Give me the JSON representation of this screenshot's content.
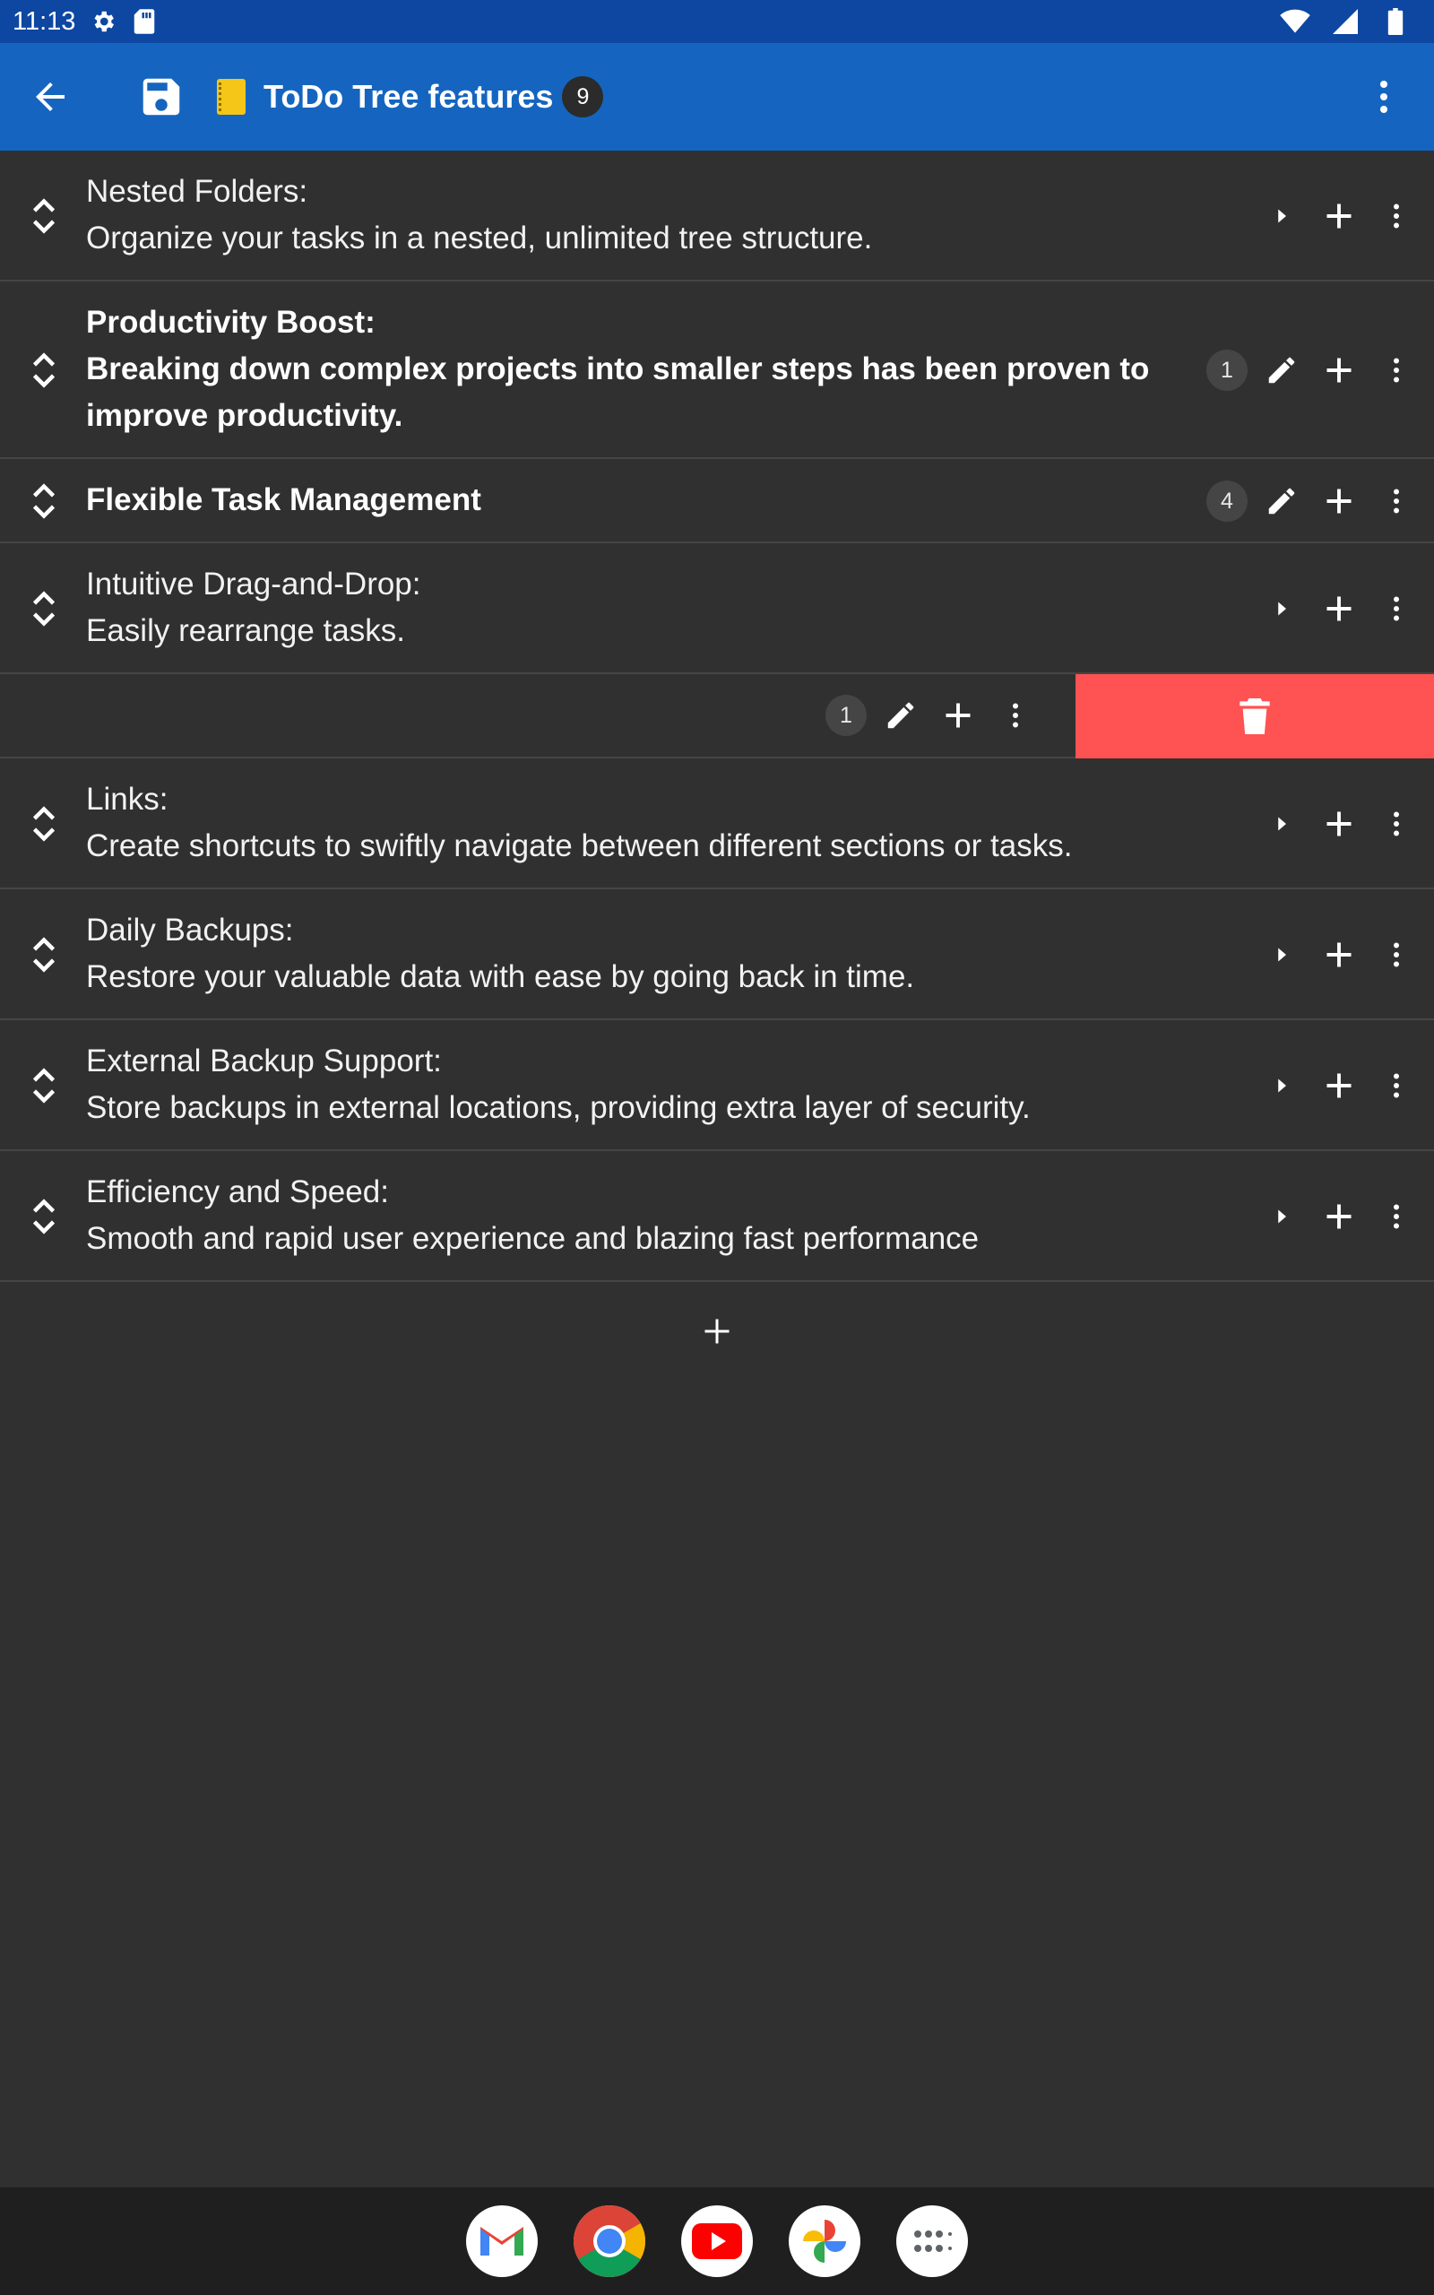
{
  "status_bar": {
    "time": "11:13"
  },
  "app_bar": {
    "title": "ToDo Tree features",
    "count": "9"
  },
  "items": [
    {
      "line1": "Nested Folders:",
      "line2": "Organize your tasks in a nested, unlimited tree structure.",
      "bold": false
    },
    {
      "line1": "Productivity Boost:",
      "line2": "Breaking down complex projects into smaller steps has been proven to",
      "line3": "improve productivity.",
      "badge": "1",
      "bold": true
    },
    {
      "line1": "Flexible Task Management",
      "badge": "4",
      "bold": true
    },
    {
      "line1": "Intuitive Drag-and-Drop:",
      "line2": "Easily rearrange tasks.",
      "bold": false
    },
    {
      "swiped_badge": "1"
    },
    {
      "line1": "Links:",
      "line2": "Create shortcuts to swiftly navigate between different sections or tasks.",
      "bold": false
    },
    {
      "line1": "Daily Backups:",
      "line2": "Restore your valuable data with ease by going back in time.",
      "bold": false
    },
    {
      "line1": "External Backup Support:",
      "line2": "Store backups in external locations, providing extra layer of security.",
      "bold": false
    },
    {
      "line1": "Efficiency and Speed:",
      "line2": "Smooth and rapid user experience and blazing fast performance",
      "bold": false
    }
  ],
  "colors": {
    "status_bar": "#0d47a1",
    "app_bar": "#1565c0",
    "background": "#303030",
    "delete": "#ff5252"
  },
  "dock": [
    "gmail-icon",
    "chrome-icon",
    "youtube-icon",
    "photos-icon",
    "app-drawer-icon"
  ]
}
